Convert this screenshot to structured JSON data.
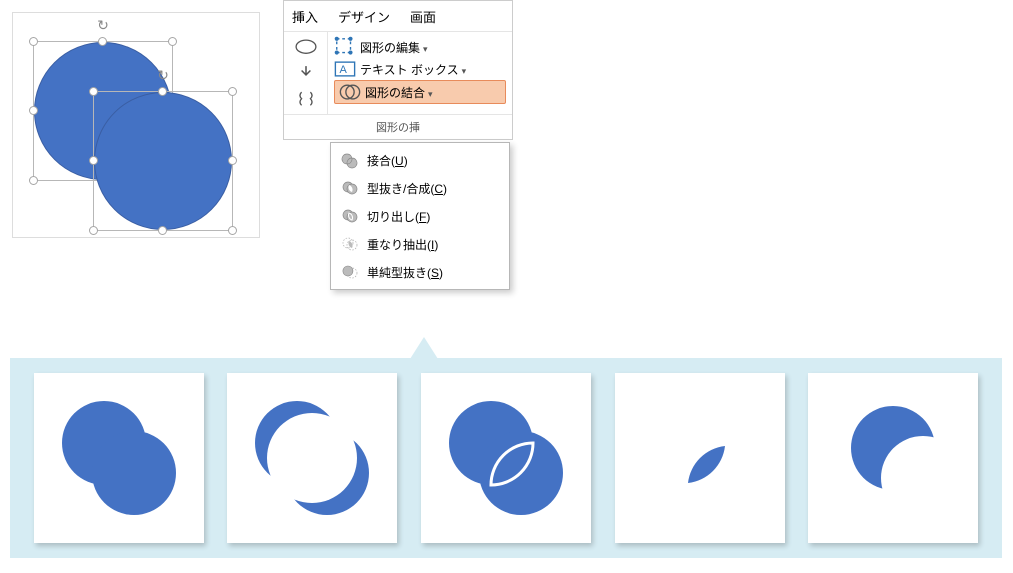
{
  "tabs": {
    "insert": "挿入",
    "design": "デザイン",
    "screen": "画面"
  },
  "ribbon": {
    "edit_shape": "図形の編集",
    "text_box": "テキスト ボックス",
    "merge_shapes": "図形の結合",
    "insert_shapes_group": "図形の挿"
  },
  "merge_menu": {
    "union": {
      "label": "接合",
      "key": "U"
    },
    "combine": {
      "label": "型抜き/合成",
      "key": "C"
    },
    "fragment": {
      "label": "切り出し",
      "key": "F"
    },
    "intersect": {
      "label": "重なり抽出",
      "key": "I"
    },
    "subtract": {
      "label": "単純型抜き",
      "key": "S"
    }
  },
  "results": {
    "union": "union-result",
    "combine": "combine-result",
    "fragment": "fragment-result",
    "intersect": "intersect-result",
    "subtract": "subtract-result"
  },
  "colors": {
    "shape_fill": "#4472c4",
    "shape_stroke": "#3a5ea3",
    "highlight_bg": "#f8cbad",
    "strip_bg": "#d6ecf3"
  }
}
